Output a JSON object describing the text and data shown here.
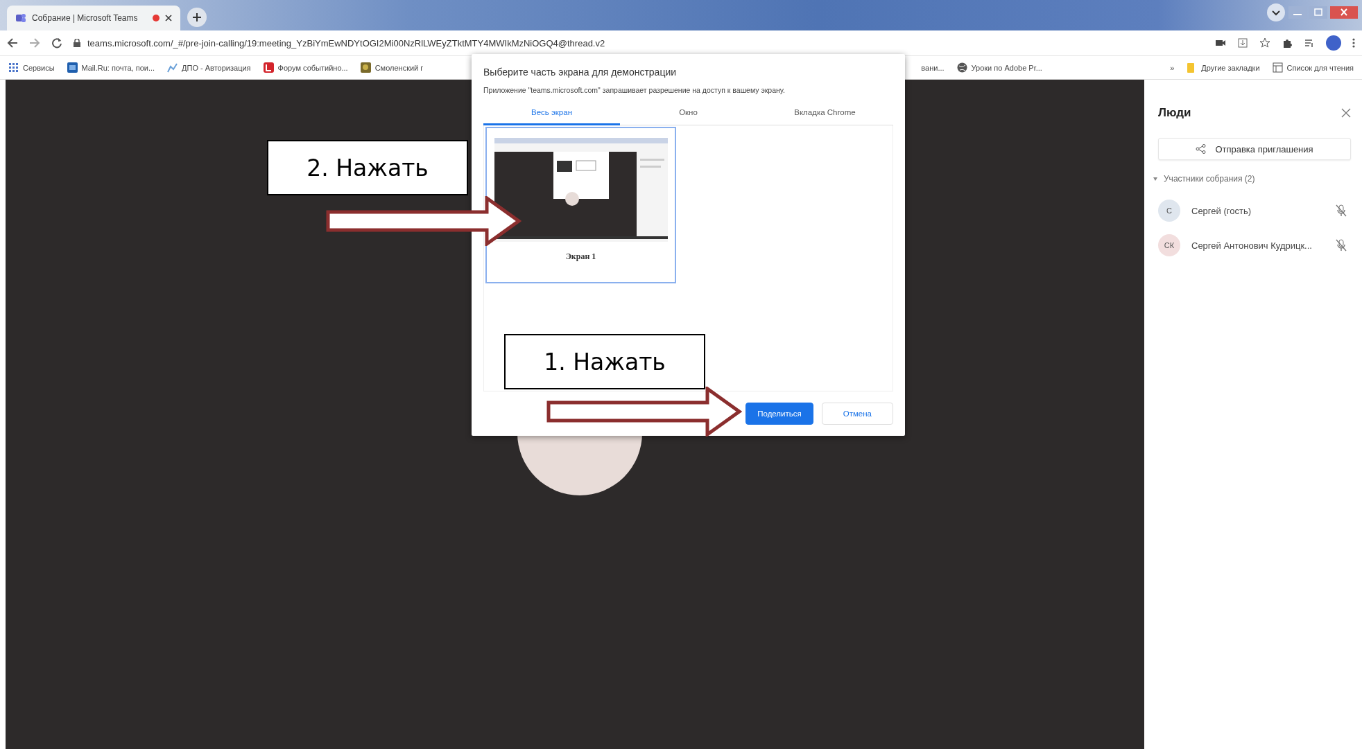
{
  "browser": {
    "tab": {
      "title": "Собрание | Microsoft Teams",
      "recording": true
    },
    "url": "teams.microsoft.com/_#/pre-join-calling/19:meeting_YzBiYmEwNDYtOGI2Mi00NzRlLWEyZTktMTY4MWIkMzNiOGQ4@thread.v2",
    "bookmarks": [
      {
        "label": "Сервисы"
      },
      {
        "label": "Mail.Ru: почта, пои..."
      },
      {
        "label": "ДПО - Авторизация"
      },
      {
        "label": "Форум событийно..."
      },
      {
        "label": "Смоленский г"
      },
      {
        "label": "вани..."
      },
      {
        "label": "Уроки по Adobe Pr..."
      }
    ],
    "more_bookmarks": "»",
    "other_bookmarks": [
      {
        "label": "Другие закладки"
      },
      {
        "label": "Список для чтения"
      }
    ]
  },
  "dialog": {
    "title": "Выберите часть экрана для демонстрации",
    "message": "Приложение \"teams.microsoft.com\" запрашивает разрешение на доступ к вашему экрану.",
    "tabs": [
      {
        "label": "Весь экран",
        "selected": true
      },
      {
        "label": "Окно",
        "selected": false
      },
      {
        "label": "Вкладка Chrome",
        "selected": false
      }
    ],
    "sources": [
      {
        "label": "Экран 1",
        "selected": true
      }
    ],
    "buttons": [
      {
        "label": "Поделиться",
        "kind": "primary"
      },
      {
        "label": "Отмена",
        "kind": "secondary"
      }
    ]
  },
  "people_panel": {
    "title": "Люди",
    "invite_button": "Отправка приглашения",
    "section": {
      "label": "Участники собрания (2)",
      "expanded": true
    },
    "participants": [
      {
        "initials": "С",
        "name": "Сергей (гость)",
        "color": "#dfe6ee",
        "muted": true
      },
      {
        "initials": "СК",
        "name": "Сергей Антонович Кудрицк...",
        "color": "#f2dede",
        "muted": true
      }
    ]
  },
  "annotations": [
    {
      "label": "2. Нажать"
    },
    {
      "label": "1. Нажать"
    }
  ]
}
